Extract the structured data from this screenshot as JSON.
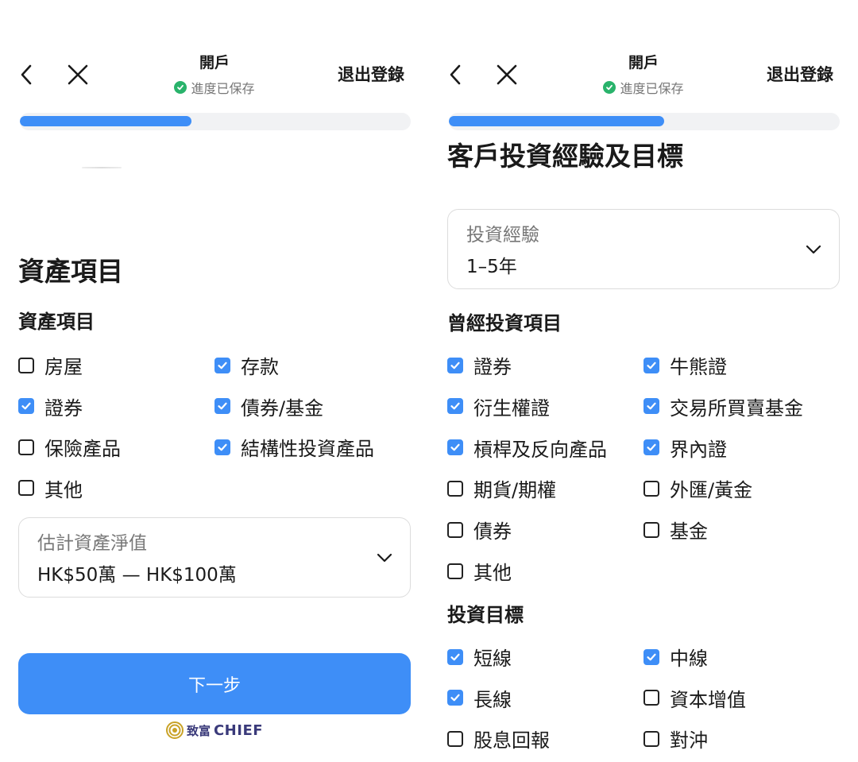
{
  "colors": {
    "accent": "#3e8ef7",
    "saved_check": "#29b36b"
  },
  "left_panel": {
    "header": {
      "title": "開戶",
      "status": "進度已保存",
      "logout": "退出登錄"
    },
    "progress": 0.44,
    "page_title": "資產項目",
    "section_title": "資產項目",
    "assets": [
      {
        "label": "房屋",
        "checked": false
      },
      {
        "label": "存款",
        "checked": true
      },
      {
        "label": "證券",
        "checked": true
      },
      {
        "label": "債券/基金",
        "checked": true
      },
      {
        "label": "保險產品",
        "checked": false
      },
      {
        "label": "結構性投資產品",
        "checked": true
      },
      {
        "label": "其他",
        "checked": false
      }
    ],
    "net_worth": {
      "label": "估計資產淨值",
      "value": "HK$50萬 — HK$100萬"
    },
    "next_button": "下一步",
    "brand": {
      "cn": "致富",
      "en": "CHIEF"
    }
  },
  "right_panel": {
    "header": {
      "title": "開戶",
      "status": "進度已保存",
      "logout": "退出登錄"
    },
    "progress": 0.55,
    "page_title": "客戶投資經驗及目標",
    "experience": {
      "label": "投資經驗",
      "value": "1–5年"
    },
    "past_section_title": "曾經投資項目",
    "past_items": [
      {
        "label": "證券",
        "checked": true
      },
      {
        "label": "牛熊證",
        "checked": true
      },
      {
        "label": "衍生權證",
        "checked": true
      },
      {
        "label": "交易所買賣基金",
        "checked": true
      },
      {
        "label": "槓桿及反向產品",
        "checked": true
      },
      {
        "label": "界內證",
        "checked": true
      },
      {
        "label": "期貨/期權",
        "checked": false
      },
      {
        "label": "外匯/黃金",
        "checked": false
      },
      {
        "label": "債券",
        "checked": false
      },
      {
        "label": "基金",
        "checked": false
      },
      {
        "label": "其他",
        "checked": false
      }
    ],
    "goals_section_title": "投資目標",
    "goals": [
      {
        "label": "短線",
        "checked": true
      },
      {
        "label": "中線",
        "checked": true
      },
      {
        "label": "長線",
        "checked": true
      },
      {
        "label": "資本增值",
        "checked": false
      },
      {
        "label": "股息回報",
        "checked": false
      },
      {
        "label": "對沖",
        "checked": false
      }
    ]
  }
}
